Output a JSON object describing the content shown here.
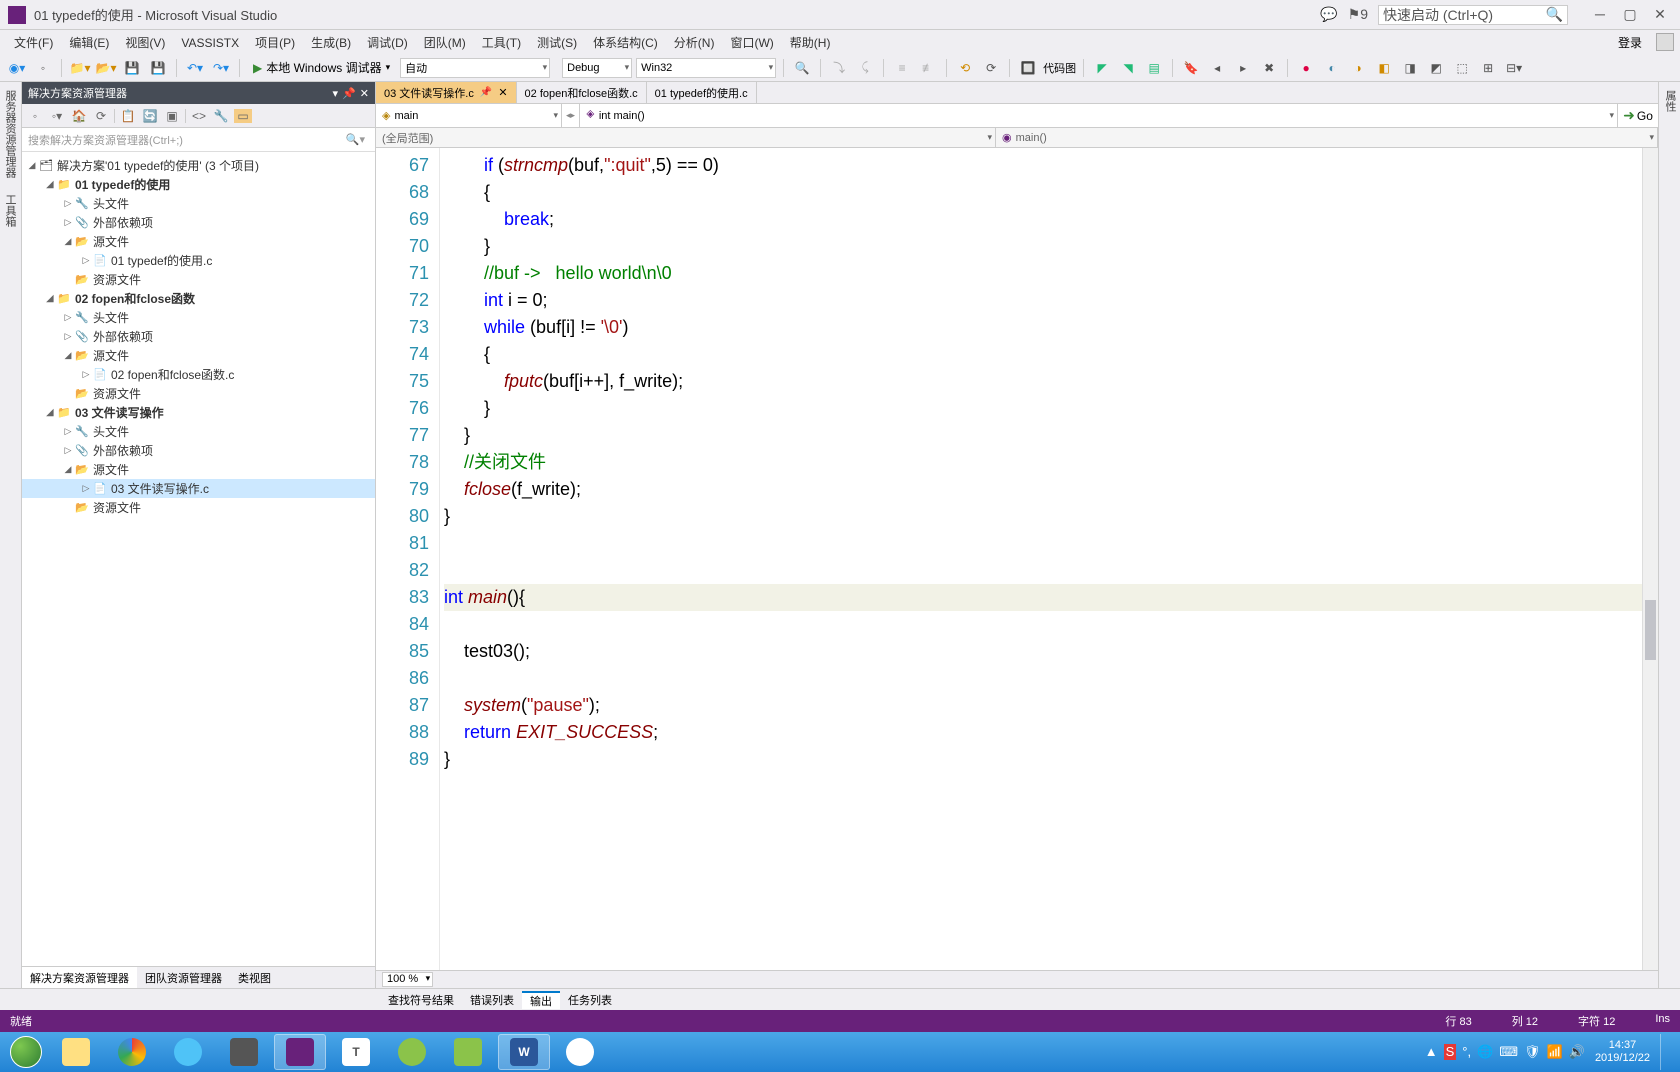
{
  "window": {
    "title": "01 typedef的使用 - Microsoft Visual Studio",
    "notif_count": "9",
    "quick_launch_placeholder": "快速启动 (Ctrl+Q)"
  },
  "menu": {
    "items": [
      "文件(F)",
      "编辑(E)",
      "视图(V)",
      "VASSISTX",
      "项目(P)",
      "生成(B)",
      "调试(D)",
      "团队(M)",
      "工具(T)",
      "测试(S)",
      "体系结构(C)",
      "分析(N)",
      "窗口(W)",
      "帮助(H)"
    ],
    "login": "登录"
  },
  "toolbar": {
    "debug_label": "本地 Windows 调试器",
    "config_auto": "自动",
    "config_debug": "Debug",
    "config_platform": "Win32",
    "code_view": "代码图"
  },
  "left_tabs": [
    "服务器资源管理器",
    "工具箱"
  ],
  "solution": {
    "panel_title": "解决方案资源管理器",
    "search_placeholder": "搜索解决方案资源管理器(Ctrl+;)",
    "root": "解决方案'01 typedef的使用' (3 个项目)",
    "tree": [
      {
        "depth": 0,
        "exp": "◢",
        "icon": "📁",
        "label": "01 typedef的使用",
        "bold": true
      },
      {
        "depth": 1,
        "exp": "▷",
        "icon": "🔧",
        "label": "头文件"
      },
      {
        "depth": 1,
        "exp": "▷",
        "icon": "📎",
        "label": "外部依赖项"
      },
      {
        "depth": 1,
        "exp": "◢",
        "icon": "📂",
        "label": "源文件"
      },
      {
        "depth": 2,
        "exp": "▷",
        "icon": "📄",
        "label": "01 typedef的使用.c"
      },
      {
        "depth": 1,
        "exp": "",
        "icon": "📂",
        "label": "资源文件"
      },
      {
        "depth": 0,
        "exp": "◢",
        "icon": "📁",
        "label": "02 fopen和fclose函数",
        "bold": true
      },
      {
        "depth": 1,
        "exp": "▷",
        "icon": "🔧",
        "label": "头文件"
      },
      {
        "depth": 1,
        "exp": "▷",
        "icon": "📎",
        "label": "外部依赖项"
      },
      {
        "depth": 1,
        "exp": "◢",
        "icon": "📂",
        "label": "源文件"
      },
      {
        "depth": 2,
        "exp": "▷",
        "icon": "📄",
        "label": "02 fopen和fclose函数.c"
      },
      {
        "depth": 1,
        "exp": "",
        "icon": "📂",
        "label": "资源文件"
      },
      {
        "depth": 0,
        "exp": "◢",
        "icon": "📁",
        "label": "03 文件读写操作",
        "bold": true
      },
      {
        "depth": 1,
        "exp": "▷",
        "icon": "🔧",
        "label": "头文件"
      },
      {
        "depth": 1,
        "exp": "▷",
        "icon": "📎",
        "label": "外部依赖项"
      },
      {
        "depth": 1,
        "exp": "◢",
        "icon": "📂",
        "label": "源文件"
      },
      {
        "depth": 2,
        "exp": "▷",
        "icon": "📄",
        "label": "03 文件读写操作.c",
        "selected": true
      },
      {
        "depth": 1,
        "exp": "",
        "icon": "📂",
        "label": "资源文件"
      }
    ],
    "bottom_tabs": [
      "解决方案资源管理器",
      "团队资源管理器",
      "类视图"
    ]
  },
  "editor": {
    "file_tabs": [
      {
        "label": "03 文件读写操作.c",
        "active": true,
        "pinned": true
      },
      {
        "label": "02 fopen和fclose函数.c"
      },
      {
        "label": "01 typedef的使用.c"
      }
    ],
    "nav_left": "main",
    "nav_right": "int main()",
    "go_label": "Go",
    "scope_left": "(全局范围)",
    "scope_right": "main()",
    "zoom": "100 %",
    "line_start": 67,
    "lines": [
      {
        "html": "        <span class='kw'>if</span> (<span class='fn'>strncmp</span>(buf,<span class='str'>\":quit\"</span>,5) == 0)"
      },
      {
        "html": "        {"
      },
      {
        "html": "            <span class='kw'>break</span>;"
      },
      {
        "html": "        }"
      },
      {
        "html": "        <span class='cmt'>//buf -&gt;   hello world\\n\\0</span>"
      },
      {
        "html": "        <span class='kw'>int</span> i = 0;"
      },
      {
        "html": "        <span class='kw'>while</span> (buf[i] != <span class='str'>'\\0'</span>)"
      },
      {
        "html": "        {"
      },
      {
        "html": "            <span class='fn'>fputc</span>(buf[i++], f_write);"
      },
      {
        "html": "        }"
      },
      {
        "html": "    }"
      },
      {
        "html": "    <span class='cmt'>//关闭文件</span>"
      },
      {
        "html": "    <span class='fn'>fclose</span>(f_write);"
      },
      {
        "html": "}"
      },
      {
        "html": ""
      },
      {
        "html": ""
      },
      {
        "html": "<span class='kw'>int</span> <span class='fn'>main</span>(){",
        "highlight": true
      },
      {
        "html": ""
      },
      {
        "html": "    test03();"
      },
      {
        "html": ""
      },
      {
        "html": "    <span class='fn'>system</span>(<span class='str'>\"pause\"</span>);"
      },
      {
        "html": "    <span class='kw'>return</span> <span class='fn'>EXIT_SUCCESS</span>;"
      },
      {
        "html": "}"
      }
    ]
  },
  "bottom_tabs": [
    "查找符号结果",
    "错误列表",
    "输出",
    "任务列表"
  ],
  "bottom_active": 2,
  "status": {
    "ready": "就绪",
    "line": "行 83",
    "col": "列 12",
    "char": "字符 12",
    "ins": "Ins"
  },
  "taskbar": {
    "time": "14:37",
    "date": "2019/12/22"
  }
}
